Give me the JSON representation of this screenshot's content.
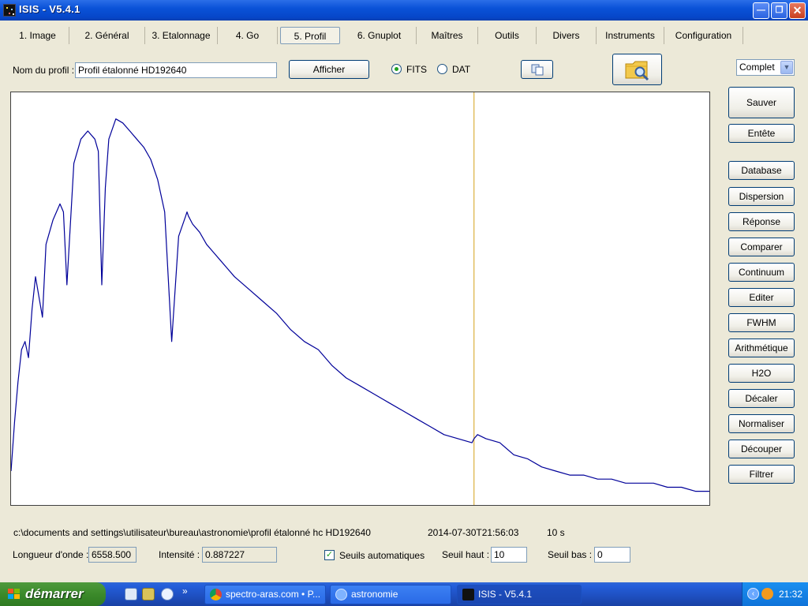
{
  "window": {
    "title": "ISIS - V5.4.1"
  },
  "tabs": [
    {
      "label": "1. Image"
    },
    {
      "label": "2. Général"
    },
    {
      "label": "3. Etalonnage"
    },
    {
      "label": "4. Go"
    },
    {
      "label": "5. Profil",
      "active": true
    },
    {
      "label": "6. Gnuplot"
    },
    {
      "label": "Maîtres"
    },
    {
      "label": "Outils"
    },
    {
      "label": "Divers"
    },
    {
      "label": "Instruments"
    },
    {
      "label": "Configuration"
    }
  ],
  "profile": {
    "name_label": "Nom du profil :",
    "name_value": "Profil étalonné HD192640",
    "show_button": "Afficher",
    "format_fits": "FITS",
    "format_dat": "DAT",
    "selected_format": "FITS",
    "mode_select": "Complet"
  },
  "side_buttons": {
    "save": "Sauver",
    "header": "Entête",
    "list": [
      {
        "label": "Database"
      },
      {
        "label": "Dispersion"
      },
      {
        "label": "Réponse"
      },
      {
        "label": "Comparer"
      },
      {
        "label": "Continuum"
      },
      {
        "label": "Editer"
      },
      {
        "label": "FWHM"
      },
      {
        "label": "Arithmétique"
      },
      {
        "label": "H2O"
      },
      {
        "label": "Décaler"
      },
      {
        "label": "Normaliser"
      },
      {
        "label": "Découper"
      },
      {
        "label": "Filtrer"
      }
    ]
  },
  "chart_data": {
    "type": "line",
    "title": "",
    "xlabel": "",
    "ylabel": "",
    "xlim": [
      0,
      100
    ],
    "ylim": [
      0,
      1
    ],
    "grid": false,
    "x": [
      0,
      0.5,
      1,
      1.5,
      2,
      2.5,
      3,
      3.5,
      4,
      4.5,
      5,
      6,
      7,
      7.5,
      8,
      9,
      10,
      11,
      12,
      12.5,
      13,
      13.5,
      14,
      15,
      16,
      17,
      18,
      19,
      20,
      21,
      22,
      23,
      24,
      25,
      25.2,
      25.4,
      26,
      27,
      28,
      29,
      30,
      31,
      32,
      34,
      36,
      38,
      40,
      42,
      44,
      46,
      48,
      50,
      52,
      54,
      56,
      58,
      60,
      62,
      64,
      66,
      66.3,
      66.8,
      68,
      70,
      72,
      74,
      76,
      78,
      80,
      82,
      84,
      86,
      88,
      90,
      92,
      94,
      96,
      98,
      100
    ],
    "y": [
      0.08,
      0.2,
      0.3,
      0.38,
      0.4,
      0.36,
      0.48,
      0.56,
      0.51,
      0.46,
      0.64,
      0.7,
      0.74,
      0.72,
      0.54,
      0.84,
      0.9,
      0.92,
      0.9,
      0.87,
      0.54,
      0.78,
      0.9,
      0.95,
      0.94,
      0.92,
      0.9,
      0.88,
      0.85,
      0.8,
      0.72,
      0.4,
      0.66,
      0.71,
      0.72,
      0.71,
      0.69,
      0.67,
      0.64,
      0.62,
      0.6,
      0.58,
      0.56,
      0.53,
      0.5,
      0.47,
      0.43,
      0.4,
      0.38,
      0.34,
      0.31,
      0.29,
      0.27,
      0.25,
      0.23,
      0.21,
      0.19,
      0.17,
      0.16,
      0.15,
      0.16,
      0.17,
      0.16,
      0.15,
      0.12,
      0.11,
      0.09,
      0.08,
      0.07,
      0.07,
      0.06,
      0.06,
      0.05,
      0.05,
      0.05,
      0.04,
      0.04,
      0.03,
      0.03
    ],
    "cursor_x": 66.3,
    "colors": {
      "line": "#000099",
      "cursor": "#d4a017",
      "background": "#ffffff"
    }
  },
  "status": {
    "path": "c:\\documents and settings\\utilisateur\\bureau\\astronomie\\profil étalonné hc HD192640",
    "datetime": "2014-07-30T21:56:03",
    "exposure": "10 s",
    "wavelength_label": "Longueur d'onde :",
    "wavelength_value": "6558.500",
    "intensity_label": "Intensité :",
    "intensity_value": "0.887227",
    "auto_thresholds_label": "Seuils automatiques",
    "auto_thresholds_checked": true,
    "high_threshold_label": "Seuil haut :",
    "high_threshold_value": "10",
    "low_threshold_label": "Seuil bas :",
    "low_threshold_value": "0"
  },
  "taskbar": {
    "start_label": "démarrer",
    "tasks": [
      {
        "label": "spectro-aras.com • P..."
      },
      {
        "label": "astronomie"
      },
      {
        "label": "ISIS - V5.4.1",
        "active": true
      }
    ],
    "clock": "21:32",
    "more_glyph": "»"
  }
}
